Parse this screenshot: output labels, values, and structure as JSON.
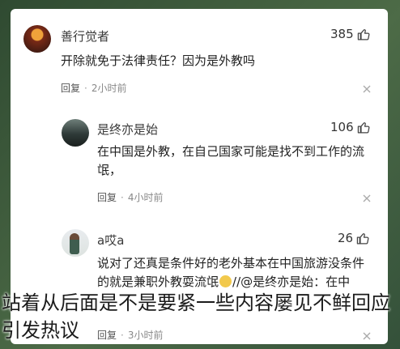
{
  "comments": [
    {
      "username": "善行觉者",
      "likes": "385",
      "text": "开除就免于法律责任？因为是外教吗",
      "reply_label": "回复",
      "time": "2小时前"
    },
    {
      "username": "是终亦是始",
      "likes": "106",
      "text": "在中国是外教，在自己国家可能是找不到工作的流氓，",
      "reply_label": "回复",
      "time": "4小时前"
    },
    {
      "username": "a哎a",
      "likes": "26",
      "text_line1": "说对了还真是条件好的老外基本在中国旅游没条件",
      "text_line2_a": "的就是兼职外教耍流氓",
      "text_line2_b": "//@是终亦是始：在中",
      "reply_label": "回复",
      "time": "3小时前"
    }
  ],
  "caption": "站着从后面是不是要紧一些内容屡见不鲜回应引发热议",
  "icons": {
    "like": "thumbs-up-icon",
    "close": "close-icon",
    "emoji": "laughing-emoji-icon"
  }
}
